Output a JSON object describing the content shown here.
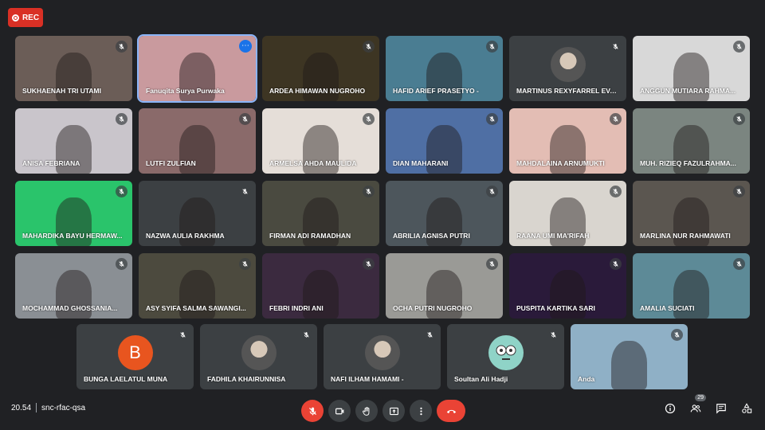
{
  "recording": {
    "label": "REC",
    "color": "#d93025"
  },
  "participants_row1": [
    {
      "name": "SUKHAENAH TRI UTAMI",
      "bg": "#6b5d57",
      "muted": true
    },
    {
      "name": "Fanuqita Surya Purwaka",
      "bg": "#c99a9e",
      "muted": false,
      "active": true
    },
    {
      "name": "ARDEA HIMAWAN NUGROHO",
      "bg": "#3d3523",
      "muted": true
    },
    {
      "name": "HAFID ARIEF PRASETYO -",
      "bg": "#4a7d92",
      "muted": true
    },
    {
      "name": "MARTINUS REXYFARREL EVAN...",
      "bg": "#3c4043",
      "muted": true,
      "avatar": "photo"
    },
    {
      "name": "ANGGUN MUTIARA RAHMA...",
      "bg": "#d8d8d8",
      "muted": true
    }
  ],
  "participants_row2": [
    {
      "name": "ANISA FEBRIANA",
      "bg": "#c9c5cb",
      "muted": true
    },
    {
      "name": "LUTFI ZULFIAN",
      "bg": "#8a6a6a",
      "muted": true
    },
    {
      "name": "ARMELSA AHDA MAULIDA",
      "bg": "#e5ded8",
      "muted": true
    },
    {
      "name": "DIAN MAHARANI",
      "bg": "#4f6fa4",
      "muted": true
    },
    {
      "name": "MAHDALAINA ARNUMUKTI",
      "bg": "#e3bdb4",
      "muted": true
    },
    {
      "name": "MUH. RIZIEQ FAZULRAHMA...",
      "bg": "#7b8580",
      "muted": true
    }
  ],
  "participants_row3": [
    {
      "name": "MAHARDIKA BAYU HERMAW...",
      "bg": "#2ac46b",
      "muted": true
    },
    {
      "name": "NAZWA AULIA RAKHMA",
      "bg": "#3c4043",
      "muted": true
    },
    {
      "name": "FIRMAN ADI RAMADHAN",
      "bg": "#4a4a40",
      "muted": true
    },
    {
      "name": "ABRILIA AGNISA PUTRI",
      "bg": "#4d565c",
      "muted": true
    },
    {
      "name": "RAANA UMI MA'RIFAH",
      "bg": "#d9d5cf",
      "muted": true
    },
    {
      "name": "MARLINA NUR RAHMAWATI",
      "bg": "#5b5650",
      "muted": true
    }
  ],
  "participants_row4": [
    {
      "name": "MOCHAMMAD GHOSSANIA...",
      "bg": "#8a8f94",
      "muted": true
    },
    {
      "name": "ASY SYIFA SALMA SAWANGI...",
      "bg": "#4c4a3e",
      "muted": true
    },
    {
      "name": "FEBRI INDRI ANI",
      "bg": "#3b2a3f",
      "muted": true
    },
    {
      "name": "OCHA PUTRI NUGROHO",
      "bg": "#9a9a96",
      "muted": true
    },
    {
      "name": "PUSPITA KARTIKA SARI",
      "bg": "#2a1a3a",
      "muted": true
    },
    {
      "name": "AMALIA SUCIATI",
      "bg": "#5d8a97",
      "muted": true
    }
  ],
  "participants_row5": [
    {
      "name": "BUNGA LAELATUL MUNA",
      "bg": "#3c4043",
      "muted": true,
      "avatar": "letter",
      "letter": "B",
      "avatar_color": "#e8551f"
    },
    {
      "name": "FADHILA KHAIRUNNISA",
      "bg": "#3c4043",
      "muted": true,
      "avatar": "photo"
    },
    {
      "name": "NAFI ILHAM HAMAMI -",
      "bg": "#3c4043",
      "muted": true,
      "avatar": "photo"
    },
    {
      "name": "Soultan Ali Hadji",
      "bg": "#3c4043",
      "muted": true,
      "avatar": "face"
    },
    {
      "name": "Anda",
      "bg": "#8fb0c6",
      "muted": true
    }
  ],
  "bottom_bar": {
    "time": "20.54",
    "meeting_code": "snc-rfac-qsa",
    "participants_count": "29"
  }
}
